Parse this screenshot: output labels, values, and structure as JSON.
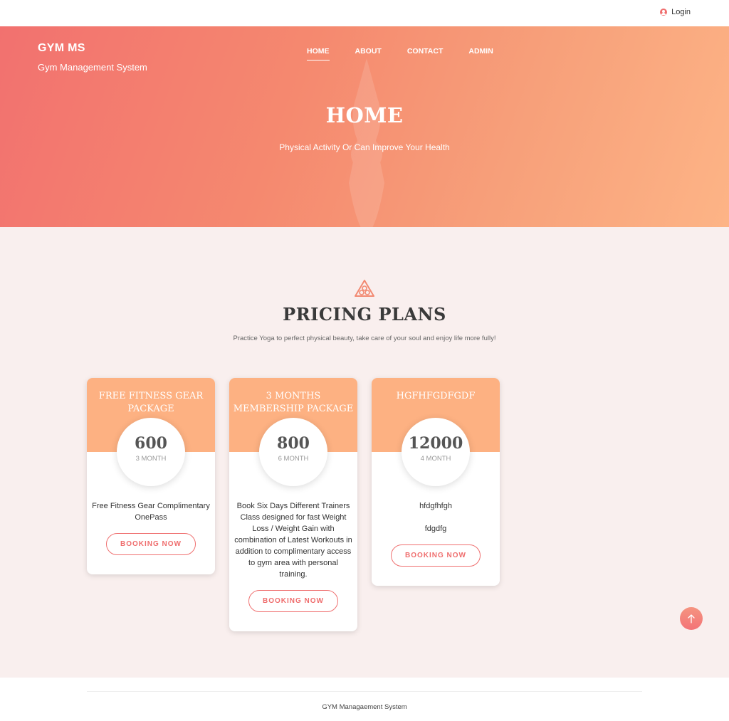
{
  "topbar": {
    "login_label": "Login",
    "login_icon": "user-circle-icon"
  },
  "brand": {
    "name": "GYM MS",
    "tagline": "Gym Management System"
  },
  "nav": {
    "items": [
      {
        "label": "HOME",
        "active": true
      },
      {
        "label": "ABOUT",
        "active": false
      },
      {
        "label": "CONTACT",
        "active": false
      },
      {
        "label": "ADMIN",
        "active": false
      }
    ]
  },
  "hero": {
    "title": "HOME",
    "subtitle": "Physical Activity Or Can Improve Your Health"
  },
  "pricing": {
    "icon": "lotus-icon",
    "title": "PRICING PLANS",
    "subtitle": "Practice Yoga to perfect physical beauty, take care of your soul and enjoy life more fully!",
    "plans": [
      {
        "name": "FREE FITNESS GEAR PACKAGE",
        "price": "600",
        "period": "3 MONTH",
        "description": [
          "Free Fitness Gear Complimentary OnePass"
        ],
        "button": "BOOKING NOW"
      },
      {
        "name": "3 MONTHS MEMBERSHIP PACKAGE",
        "price": "800",
        "period": "6 MONTH",
        "description": [
          "Book Six Days Different Trainers Class designed for fast Weight Loss / Weight Gain with combination of Latest Workouts in addition to complimentary access to gym area with personal training."
        ],
        "button": "BOOKING NOW"
      },
      {
        "name": "HGFHFGDFGDF",
        "price": "12000",
        "period": "4 MONTH",
        "description": [
          "hfdgfhfgh",
          "fdgdfg"
        ],
        "button": "BOOKING NOW"
      }
    ]
  },
  "scroll_top": {
    "icon": "arrow-up-icon"
  },
  "footer": {
    "text": "GYM Managaement System"
  },
  "colors": {
    "accent": "#ef6d6d",
    "card_header": "#fdb182",
    "section_bg": "#f9efee"
  }
}
